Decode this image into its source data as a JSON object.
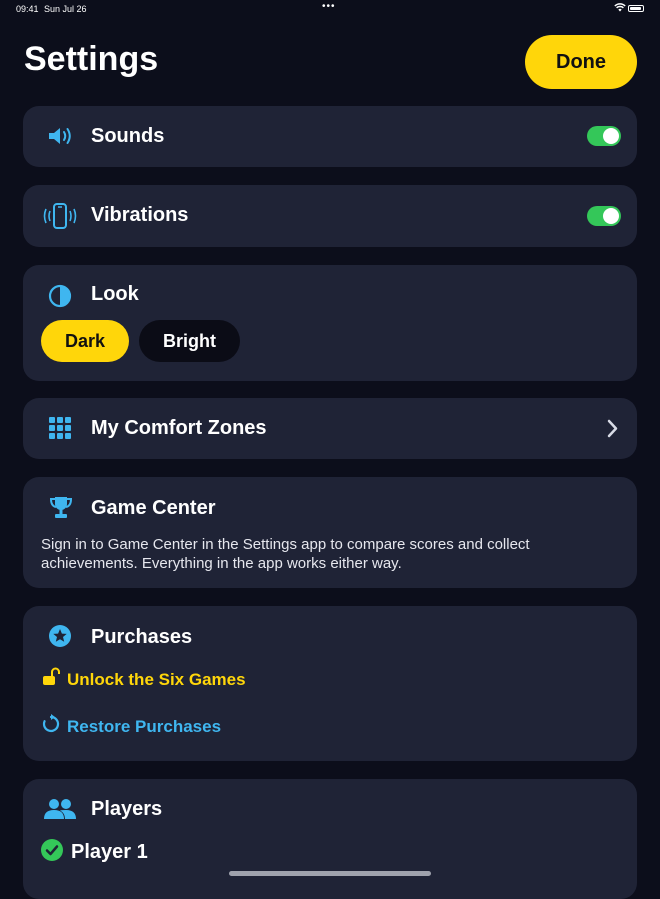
{
  "status_bar": {
    "time": "09:41",
    "date": "Sun Jul 26",
    "dots": "•••"
  },
  "header": {
    "title": "Settings",
    "done_label": "Done"
  },
  "sounds": {
    "label": "Sounds",
    "enabled": true,
    "icon": "speaker-icon"
  },
  "vibrations": {
    "label": "Vibrations",
    "enabled": true,
    "icon": "phone-vibrate-icon"
  },
  "look": {
    "label": "Look",
    "icon": "contrast-icon",
    "options": [
      "Dark",
      "Bright"
    ],
    "selected": "Dark"
  },
  "comfort_zones": {
    "label": "My Comfort Zones",
    "icon": "grid-icon"
  },
  "game_center": {
    "label": "Game Center",
    "icon": "trophy-icon",
    "description": "Sign in to Game Center in the Settings app to compare scores and collect achievements. Everything in the app works either way."
  },
  "purchases": {
    "label": "Purchases",
    "icon": "star-badge-icon",
    "unlock_label": "Unlock the Six Games",
    "restore_label": "Restore Purchases"
  },
  "players": {
    "label": "Players",
    "icon": "people-icon",
    "items": [
      {
        "name": "Player 1",
        "selected": true
      }
    ]
  },
  "colors": {
    "background": "#0c0e1b",
    "card": "#1f2336",
    "accent_yellow": "#ffd60a",
    "accent_blue": "#3fb6f0",
    "toggle_on": "#34c759"
  }
}
